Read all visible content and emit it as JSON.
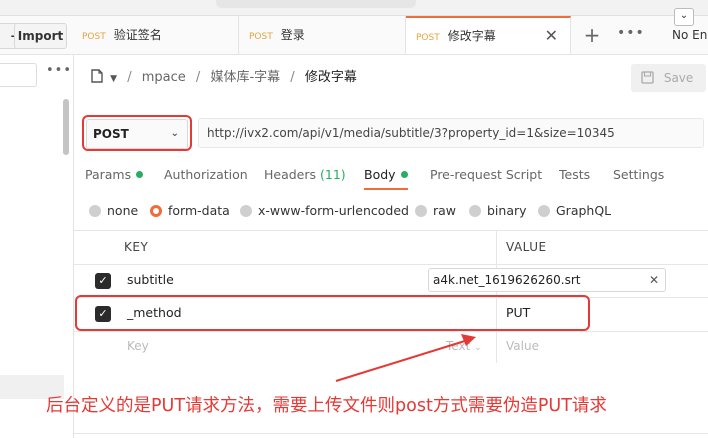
{
  "window": {
    "import_label": "Import",
    "sidebar_more": "•••"
  },
  "tabs": [
    {
      "method": "POST",
      "title": "验证签名"
    },
    {
      "method": "POST",
      "title": "登录"
    },
    {
      "method": "POST",
      "title": "修改字幕",
      "active": true
    }
  ],
  "tab_actions": {
    "add": "+",
    "more": "•••",
    "close": "✕"
  },
  "environment": {
    "label": "No En",
    "dropdown": "⌄"
  },
  "breadcrumb": {
    "items": [
      "mpace",
      "媒体库-字幕"
    ],
    "current": "修改字幕",
    "separator": "/"
  },
  "save_label": "Save",
  "request": {
    "method": "POST",
    "url": "http://ivx2.com/api/v1/media/subtitle/3?property_id=1&size=10345"
  },
  "subtabs": [
    {
      "label": "Params",
      "dot": true
    },
    {
      "label": "Authorization"
    },
    {
      "label": "Headers",
      "count": "(11)"
    },
    {
      "label": "Body",
      "dot": true,
      "active": true
    },
    {
      "label": "Pre-request Script"
    },
    {
      "label": "Tests"
    },
    {
      "label": "Settings"
    }
  ],
  "body_types": [
    "none",
    "form-data",
    "x-www-form-urlencoded",
    "raw",
    "binary",
    "GraphQL"
  ],
  "body_selected": "form-data",
  "table": {
    "headers": {
      "key": "KEY",
      "value": "VALUE"
    },
    "rows": [
      {
        "key": "subtitle",
        "value": "a4k.net_1619626260.srt",
        "checked": true
      },
      {
        "key": "_method",
        "value": "PUT",
        "checked": true
      }
    ],
    "placeholder": {
      "key": "Key",
      "type": "Text",
      "value": "Value"
    }
  },
  "annotation": "后台定义的是PUT请求方法，需要上传文件则post方式需要伪造PUT请求",
  "colors": {
    "accent": "#f26b3a",
    "annotation": "#e53935",
    "method": "#e7a33e",
    "active_dot": "#27ae60"
  }
}
